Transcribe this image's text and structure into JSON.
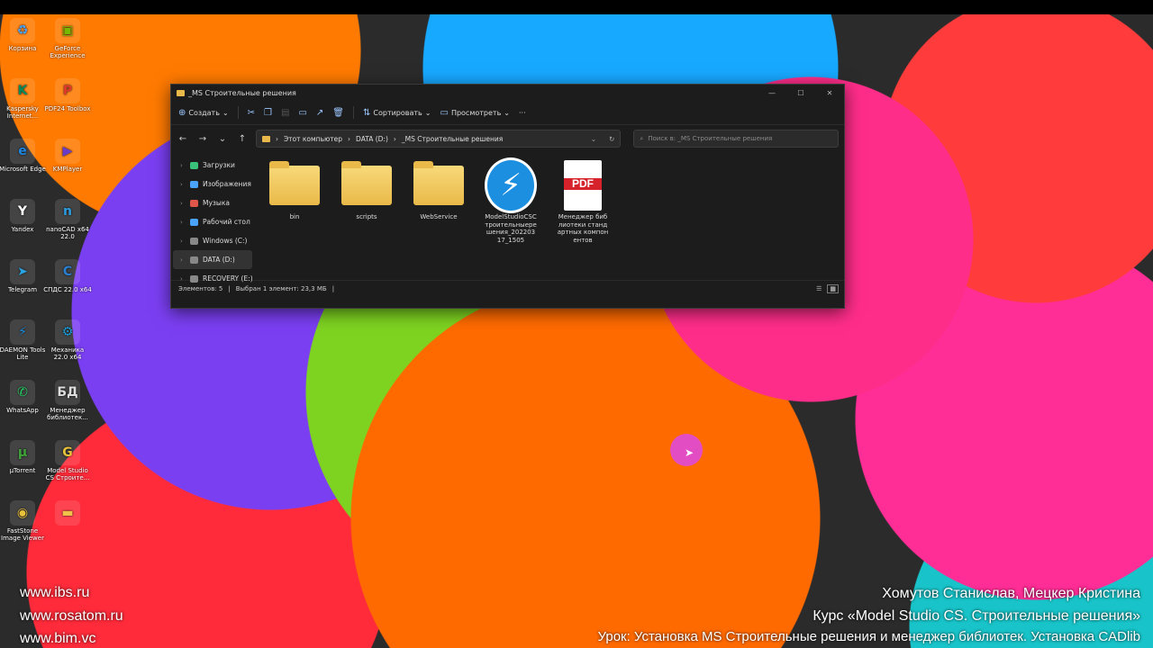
{
  "desktop": {
    "icons": [
      {
        "label": "Корзина",
        "glyph": "♻",
        "color": "#4aa3ff"
      },
      {
        "label": "GeForce Experience",
        "glyph": "▣",
        "color": "#76b900"
      },
      {
        "label": "Kaspersky Internet...",
        "glyph": "K",
        "color": "#0a8a5a"
      },
      {
        "label": "PDF24 Toolbox",
        "glyph": "P",
        "color": "#e23b2e"
      },
      {
        "label": "Microsoft Edge",
        "glyph": "e",
        "color": "#1e88e5"
      },
      {
        "label": "KMPlayer",
        "glyph": "▶",
        "color": "#6a3cc8"
      },
      {
        "label": "Yandex",
        "glyph": "Y",
        "color": "#ffffff"
      },
      {
        "label": "nanoCAD x64 22.0",
        "glyph": "n",
        "color": "#2c9ce0"
      },
      {
        "label": "Telegram",
        "glyph": "➤",
        "color": "#2aa3e0"
      },
      {
        "label": "СПДС 22.0 x64",
        "glyph": "С",
        "color": "#2a7fd0"
      },
      {
        "label": "DAEMON Tools Lite",
        "glyph": "⚡",
        "color": "#1d8fe0"
      },
      {
        "label": "Механика 22.0 x64",
        "glyph": "⚙",
        "color": "#1a9cd8"
      },
      {
        "label": "WhatsApp",
        "glyph": "✆",
        "color": "#25d366"
      },
      {
        "label": "Менеджер библиотек...",
        "glyph": "БД",
        "color": "#dddddd"
      },
      {
        "label": "µTorrent",
        "glyph": "µ",
        "color": "#3fa33a"
      },
      {
        "label": "Model Studio CS Строите...",
        "glyph": "G",
        "color": "#e8c13b"
      },
      {
        "label": "FastStone Image Viewer",
        "glyph": "◉",
        "color": "#e8c13b"
      },
      {
        "label": "",
        "glyph": "▬",
        "color": "#f1c24a"
      }
    ],
    "watermarks_left": [
      "www.ibs.ru",
      "www.rosatom.ru",
      "www.bim.vc"
    ],
    "watermarks_right": [
      "Хомутов Станислав, Мецкер Кристина",
      "Курс «Model Studio CS. Строительные решения»"
    ],
    "lesson_caption": "Урок: Установка MS Строительные решения и менеджер библиотек. Установка CADlib"
  },
  "explorer": {
    "title": "_MS Строительные решения",
    "window_buttons": [
      "—",
      "☐",
      "✕"
    ],
    "toolbar": {
      "create": "Создать",
      "sort": "Сортировать",
      "view": "Просмотреть",
      "more": "···"
    },
    "address": {
      "path": [
        "Этот компьютер",
        "DATA (D:)",
        "_MS Строительные решения"
      ],
      "search_placeholder": "Поиск в: _MS Строительные решения"
    },
    "sidebar": [
      {
        "label": "Загрузки",
        "color": "#3ac27a"
      },
      {
        "label": "Изображения",
        "color": "#4aa3ff"
      },
      {
        "label": "Музыка",
        "color": "#e0564a"
      },
      {
        "label": "Рабочий стол",
        "color": "#4aa3ff"
      },
      {
        "label": "Windows (C:)",
        "color": "#888888"
      },
      {
        "label": "DATA (D:)",
        "color": "#888888"
      },
      {
        "label": "RECOVERY (E:)",
        "color": "#888888"
      }
    ],
    "files": [
      {
        "name": "bin",
        "type": "folder"
      },
      {
        "name": "scripts",
        "type": "folder"
      },
      {
        "name": "WebService",
        "type": "folder"
      },
      {
        "name": "ModelStudioCSСтроительныерешения_20220317_1505",
        "type": "app"
      },
      {
        "name": "Менеджер библиотеки стандартных компонентов",
        "type": "pdf",
        "badge": "PDF"
      }
    ],
    "status": {
      "items": "Элементов: 5",
      "selected": "Выбран 1 элемент: 23,3 МБ"
    }
  }
}
